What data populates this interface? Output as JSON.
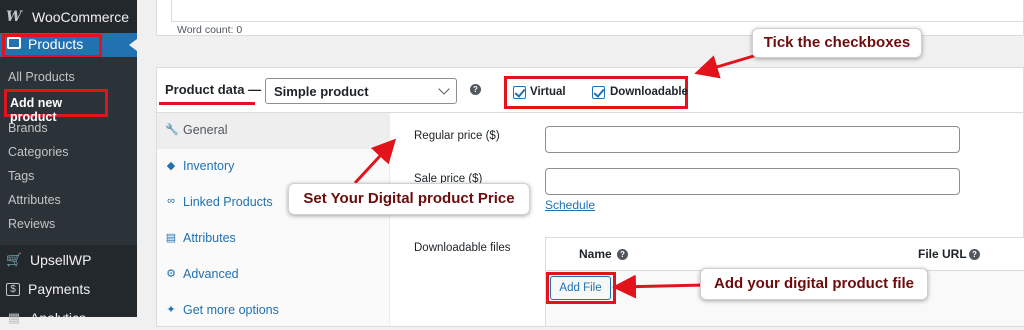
{
  "sidebar": {
    "woocommerce_label": "WooCommerce",
    "products_label": "Products",
    "submenu": [
      "All Products",
      "Add new product",
      "Brands",
      "Categories",
      "Tags",
      "Attributes",
      "Reviews"
    ],
    "current_item": "Add new product",
    "lower": [
      {
        "label": "UpsellWP",
        "icon": "cart-icon"
      },
      {
        "label": "Payments",
        "icon": "dollar-icon"
      },
      {
        "label": "Analytics",
        "icon": "chart-icon"
      }
    ]
  },
  "editor": {
    "word_count": "Word count: 0"
  },
  "product_data": {
    "title": "Product data —",
    "type_select": "Simple product",
    "virtual_label": "Virtual",
    "downloadable_label": "Downloadable",
    "virtual_checked": true,
    "downloadable_checked": true
  },
  "tabs": [
    {
      "label": "General",
      "icon": "wrench-icon"
    },
    {
      "label": "Inventory",
      "icon": "tag-icon"
    },
    {
      "label": "Linked Products",
      "icon": "link-icon"
    },
    {
      "label": "Attributes",
      "icon": "table-icon"
    },
    {
      "label": "Advanced",
      "icon": "gear-icon"
    },
    {
      "label": "Get more options",
      "icon": "plug-icon"
    }
  ],
  "general": {
    "regular_price_label": "Regular price ($)",
    "sale_price_label": "Sale price ($)",
    "schedule_link": "Schedule",
    "downloadable_files_label": "Downloadable files",
    "col_name": "Name",
    "col_file_url": "File URL",
    "add_file": "Add File"
  },
  "annotations": {
    "checkboxes": "Tick the checkboxes",
    "price": "Set Your Digital product Price",
    "file": "Add your digital product file"
  },
  "colors": {
    "highlight": "#e1141c",
    "accent": "#2271b1",
    "annotation_text": "#6b0d0d"
  }
}
